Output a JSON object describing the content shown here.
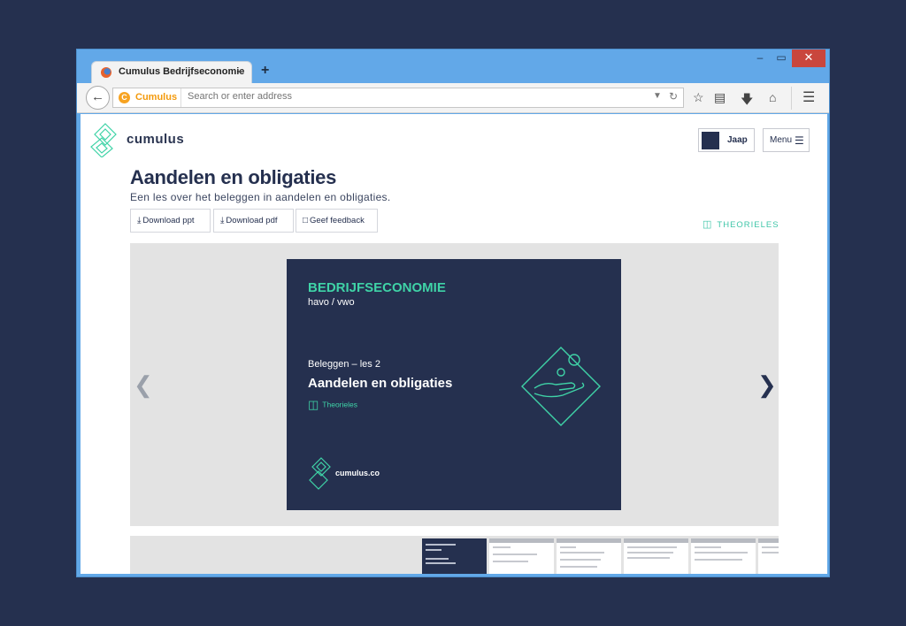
{
  "browser": {
    "tab_title": "Cumulus Bedrijfseconomie",
    "tab_close": "×",
    "new_tab": "+",
    "identity_label": "Cumulus",
    "url_placeholder": "Search or enter address",
    "window_controls": {
      "minimize": "–",
      "maximize": "▭",
      "close": "✕"
    }
  },
  "site": {
    "brand": "cumulus",
    "user_name": "Jaap",
    "menu_label": "Menu"
  },
  "page": {
    "title": "Aandelen en obligaties",
    "subtitle": "Een les over het beleggen in aandelen en obligaties.",
    "actions": {
      "download_ppt": "Download ppt",
      "download_pdf": "Download pdf",
      "feedback": "Geef feedback"
    },
    "lesson_type": "THEORIELES"
  },
  "slide": {
    "subject": "BEDRIJFSECONOMIE",
    "level": "havo / vwo",
    "lesson": "Beleggen – les 2",
    "title": "Aandelen en obligaties",
    "tag": "Theorieles",
    "site_url": "cumulus.co"
  },
  "colors": {
    "navy": "#25304f",
    "accent_green": "#3fd3a7",
    "browser_blue": "#62a8e8",
    "close_red": "#c9463d"
  },
  "icons": {
    "back": "arrow-left-icon",
    "bookmark": "star-icon",
    "reading_list": "clipboard-icon",
    "downloads": "download-icon",
    "home": "home-icon",
    "app_menu": "hamburger-icon",
    "prev": "chevron-left-icon",
    "next": "chevron-right-icon"
  }
}
